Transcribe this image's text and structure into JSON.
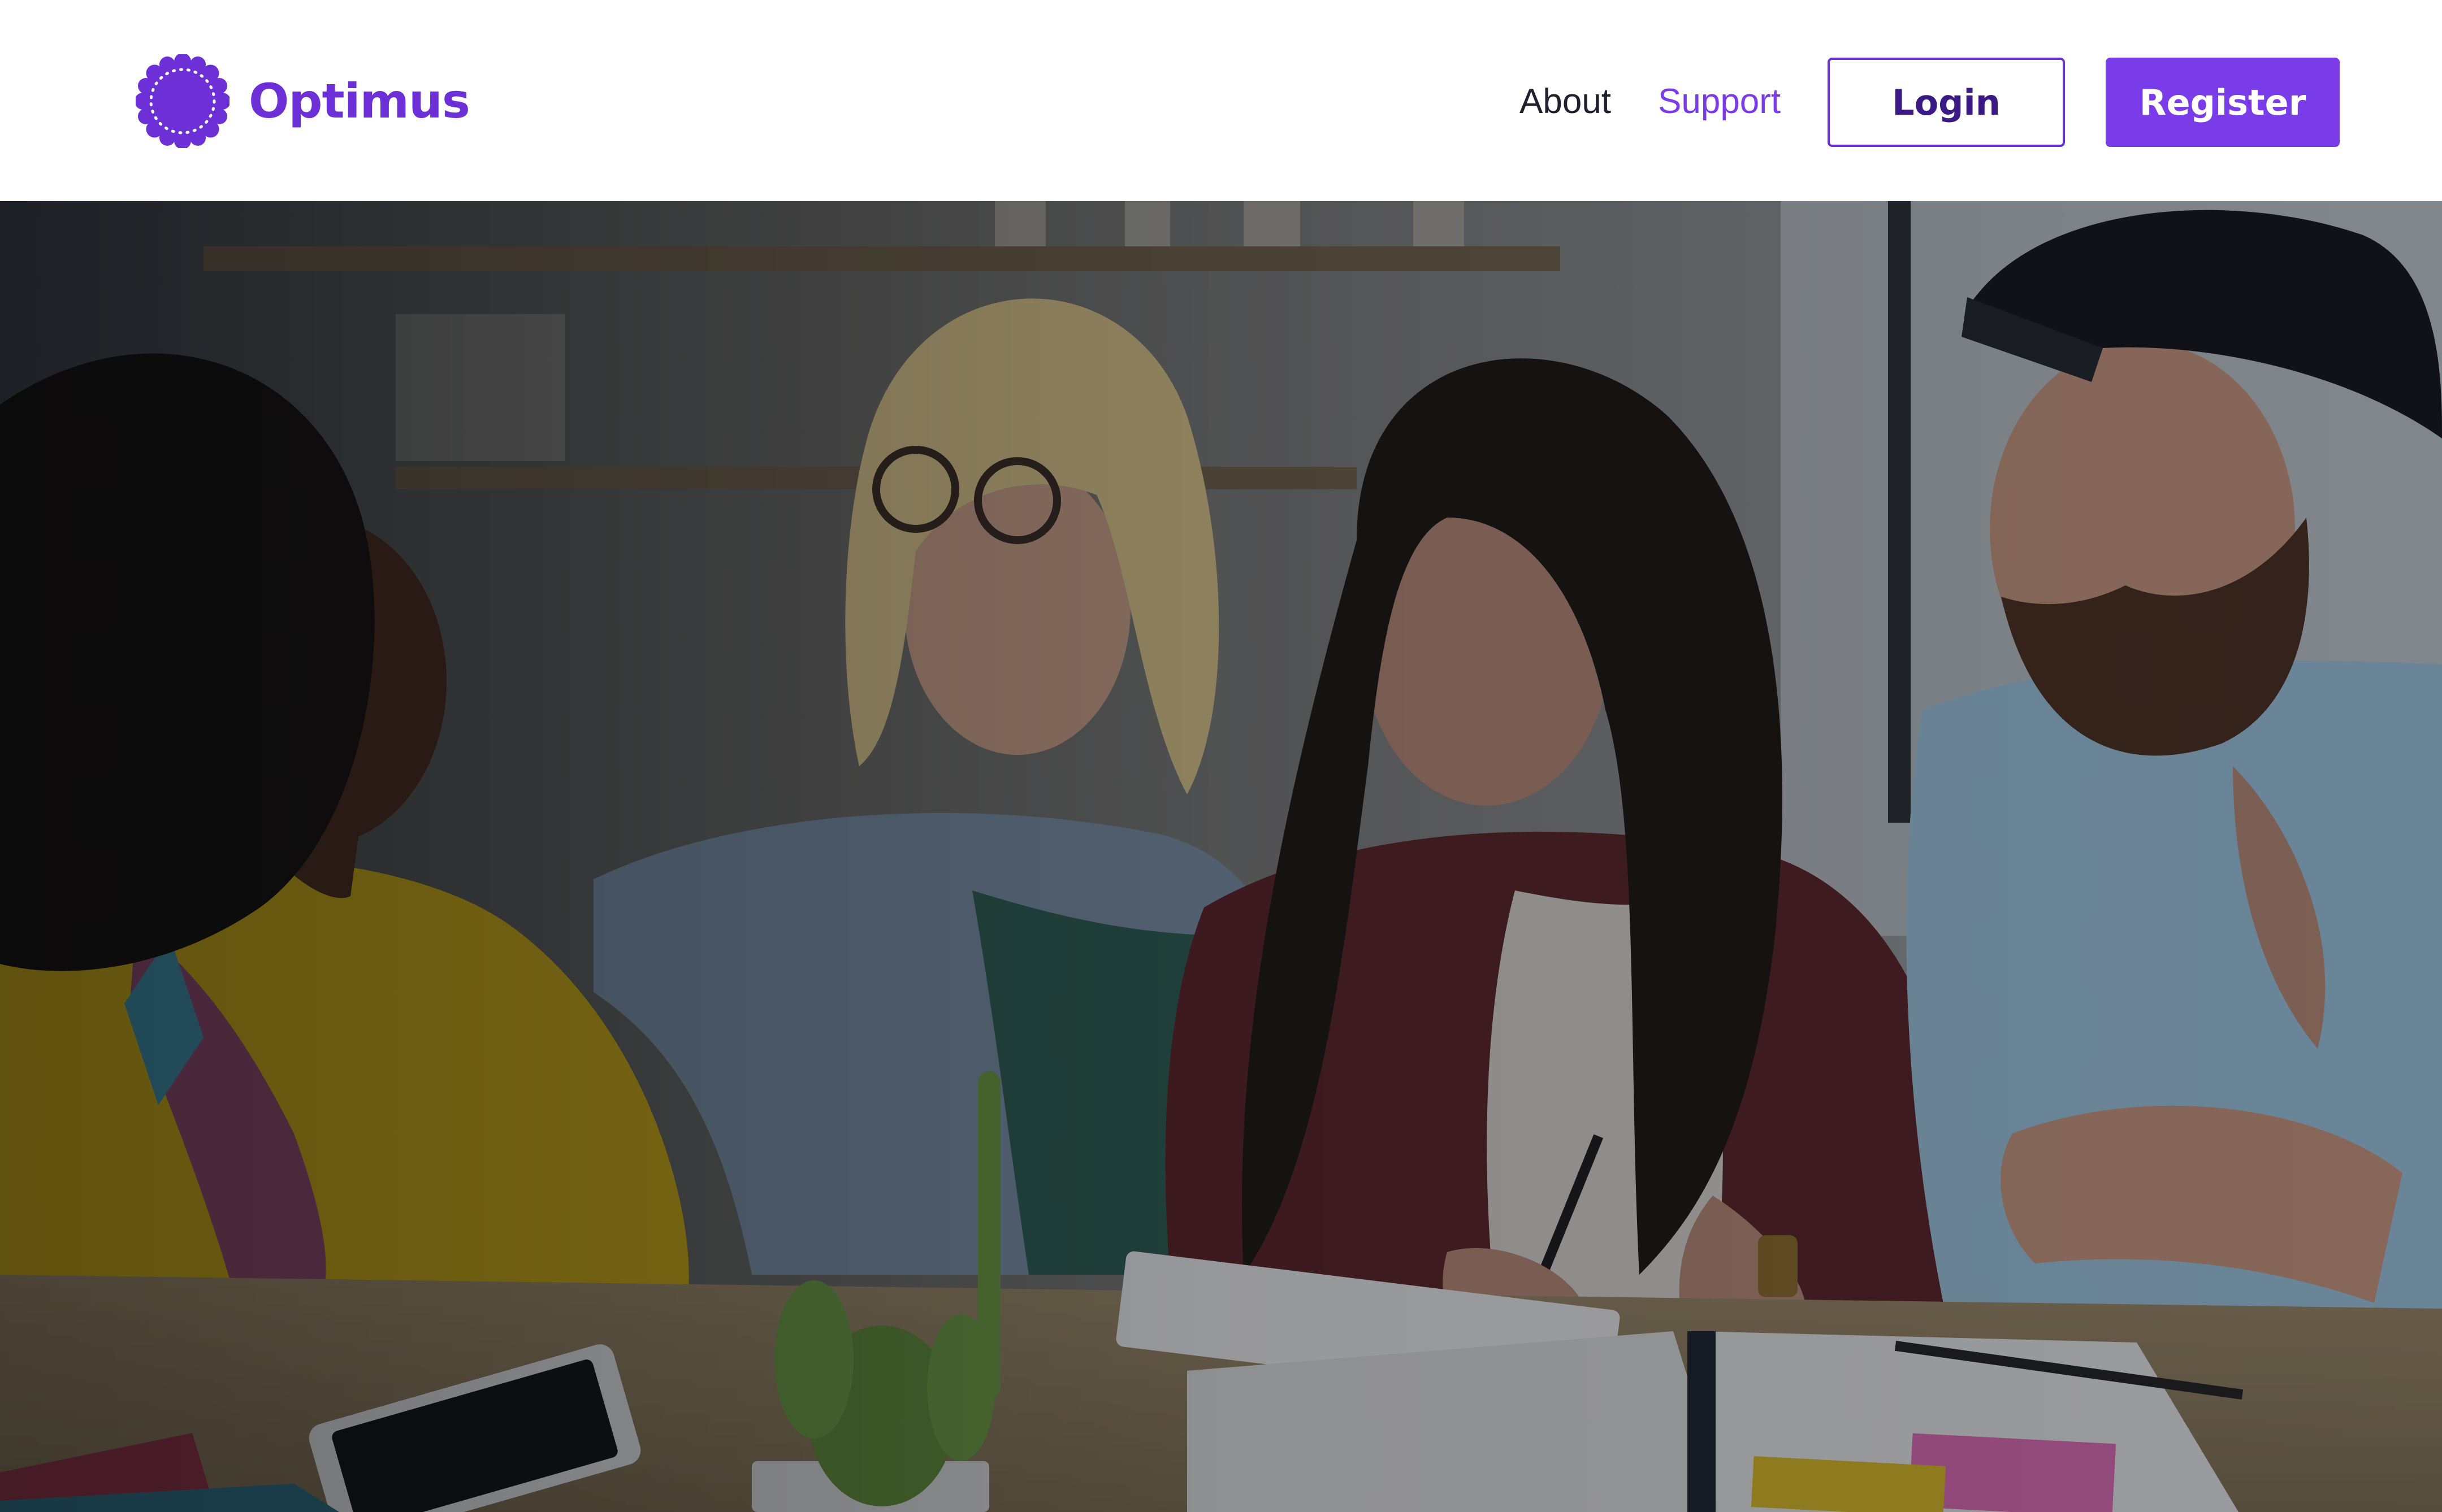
{
  "brand": {
    "name": "Optimus",
    "logo_icon": "flower-badge-icon",
    "color": "#6d2fd6"
  },
  "nav": {
    "links": [
      {
        "label": "About",
        "color": "#1f1f2e"
      },
      {
        "label": "Support",
        "color": "#7a3be8"
      }
    ],
    "login_label": "Login",
    "register_label": "Register"
  },
  "colors": {
    "accent": "#7a3be8",
    "accent_dark": "#3b1a86",
    "text": "#1f1f2e",
    "background": "#ffffff"
  },
  "hero": {
    "image": "photo of four young adults talking around a table with a tablet, cactus and phone",
    "overlay": "dark tint"
  }
}
